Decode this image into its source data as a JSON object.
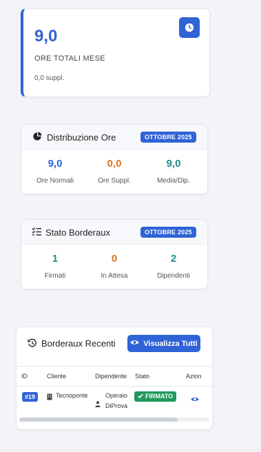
{
  "stat": {
    "value": "9,0",
    "label": "ORE TOTALI MESE",
    "sub": "0,0 suppl."
  },
  "distribuzione": {
    "title": "Distribuzione Ore",
    "badge": "OTTOBRE 2025",
    "metrics": [
      {
        "value": "9,0",
        "label": "Ore Normali",
        "color": "#2f63d6"
      },
      {
        "value": "0,0",
        "label": "Ore Suppl.",
        "color": "#d9731f"
      },
      {
        "value": "9,0",
        "label": "Media/Dip.",
        "color": "#1f8a8f"
      }
    ]
  },
  "stato": {
    "title": "Stato Borderaux",
    "badge": "OTTOBRE 2025",
    "metrics": [
      {
        "value": "1",
        "label": "Firmati",
        "color": "#1f9a5b"
      },
      {
        "value": "0",
        "label": "In Attesa",
        "color": "#d9731f"
      },
      {
        "value": "2",
        "label": "Dipendenti",
        "color": "#1f8a8f"
      }
    ]
  },
  "recenti": {
    "title": "Borderaux Recenti",
    "view_all": "Visualizza Tutti",
    "columns": [
      "ID",
      "Cliente",
      "Dipendente",
      "Stato",
      "Azion"
    ],
    "rows": [
      {
        "id": "#19",
        "cliente": "Tecnoponte",
        "dipendente_1": "Operaio",
        "dipendente_2": "DiProva",
        "stato": "FIRMATO"
      }
    ]
  },
  "icons": {
    "stat": "clock-icon",
    "distribuzione": "pie-chart-icon",
    "stato": "checklist-icon",
    "recenti": "history-icon",
    "view_all": "eye-icon",
    "cliente": "building-icon",
    "dipendente": "user-icon",
    "stato_row": "check-icon",
    "azione": "eye-icon"
  },
  "colors": {
    "primary": "#2f63d6",
    "success": "#1f9a5b",
    "warning": "#d9731f",
    "teal": "#1f8a8f"
  }
}
